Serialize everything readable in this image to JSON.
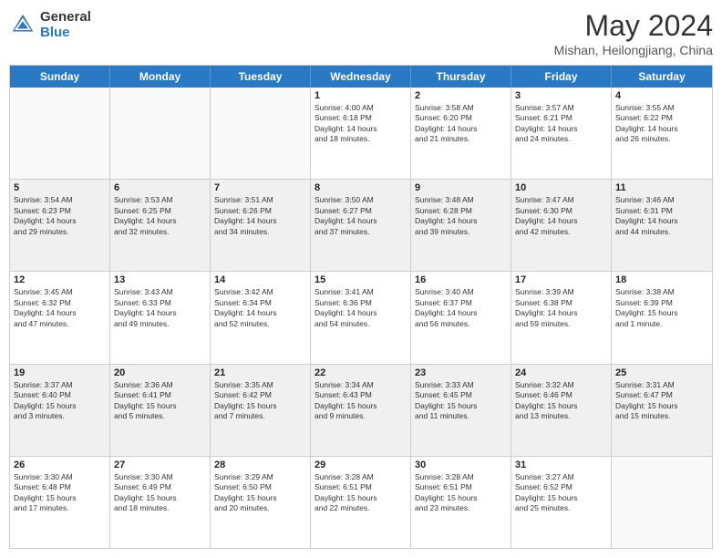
{
  "logo": {
    "line1": "General",
    "line2": "Blue"
  },
  "title": "May 2024",
  "location": "Mishan, Heilongjiang, China",
  "days_of_week": [
    "Sunday",
    "Monday",
    "Tuesday",
    "Wednesday",
    "Thursday",
    "Friday",
    "Saturday"
  ],
  "weeks": [
    [
      {
        "day": "",
        "info": ""
      },
      {
        "day": "",
        "info": ""
      },
      {
        "day": "",
        "info": ""
      },
      {
        "day": "1",
        "info": "Sunrise: 4:00 AM\nSunset: 6:18 PM\nDaylight: 14 hours\nand 18 minutes."
      },
      {
        "day": "2",
        "info": "Sunrise: 3:58 AM\nSunset: 6:20 PM\nDaylight: 14 hours\nand 21 minutes."
      },
      {
        "day": "3",
        "info": "Sunrise: 3:57 AM\nSunset: 6:21 PM\nDaylight: 14 hours\nand 24 minutes."
      },
      {
        "day": "4",
        "info": "Sunrise: 3:55 AM\nSunset: 6:22 PM\nDaylight: 14 hours\nand 26 minutes."
      }
    ],
    [
      {
        "day": "5",
        "info": "Sunrise: 3:54 AM\nSunset: 6:23 PM\nDaylight: 14 hours\nand 29 minutes."
      },
      {
        "day": "6",
        "info": "Sunrise: 3:53 AM\nSunset: 6:25 PM\nDaylight: 14 hours\nand 32 minutes."
      },
      {
        "day": "7",
        "info": "Sunrise: 3:51 AM\nSunset: 6:26 PM\nDaylight: 14 hours\nand 34 minutes."
      },
      {
        "day": "8",
        "info": "Sunrise: 3:50 AM\nSunset: 6:27 PM\nDaylight: 14 hours\nand 37 minutes."
      },
      {
        "day": "9",
        "info": "Sunrise: 3:48 AM\nSunset: 6:28 PM\nDaylight: 14 hours\nand 39 minutes."
      },
      {
        "day": "10",
        "info": "Sunrise: 3:47 AM\nSunset: 6:30 PM\nDaylight: 14 hours\nand 42 minutes."
      },
      {
        "day": "11",
        "info": "Sunrise: 3:46 AM\nSunset: 6:31 PM\nDaylight: 14 hours\nand 44 minutes."
      }
    ],
    [
      {
        "day": "12",
        "info": "Sunrise: 3:45 AM\nSunset: 6:32 PM\nDaylight: 14 hours\nand 47 minutes."
      },
      {
        "day": "13",
        "info": "Sunrise: 3:43 AM\nSunset: 6:33 PM\nDaylight: 14 hours\nand 49 minutes."
      },
      {
        "day": "14",
        "info": "Sunrise: 3:42 AM\nSunset: 6:34 PM\nDaylight: 14 hours\nand 52 minutes."
      },
      {
        "day": "15",
        "info": "Sunrise: 3:41 AM\nSunset: 6:36 PM\nDaylight: 14 hours\nand 54 minutes."
      },
      {
        "day": "16",
        "info": "Sunrise: 3:40 AM\nSunset: 6:37 PM\nDaylight: 14 hours\nand 56 minutes."
      },
      {
        "day": "17",
        "info": "Sunrise: 3:39 AM\nSunset: 6:38 PM\nDaylight: 14 hours\nand 59 minutes."
      },
      {
        "day": "18",
        "info": "Sunrise: 3:38 AM\nSunset: 6:39 PM\nDaylight: 15 hours\nand 1 minute."
      }
    ],
    [
      {
        "day": "19",
        "info": "Sunrise: 3:37 AM\nSunset: 6:40 PM\nDaylight: 15 hours\nand 3 minutes."
      },
      {
        "day": "20",
        "info": "Sunrise: 3:36 AM\nSunset: 6:41 PM\nDaylight: 15 hours\nand 5 minutes."
      },
      {
        "day": "21",
        "info": "Sunrise: 3:35 AM\nSunset: 6:42 PM\nDaylight: 15 hours\nand 7 minutes."
      },
      {
        "day": "22",
        "info": "Sunrise: 3:34 AM\nSunset: 6:43 PM\nDaylight: 15 hours\nand 9 minutes."
      },
      {
        "day": "23",
        "info": "Sunrise: 3:33 AM\nSunset: 6:45 PM\nDaylight: 15 hours\nand 11 minutes."
      },
      {
        "day": "24",
        "info": "Sunrise: 3:32 AM\nSunset: 6:46 PM\nDaylight: 15 hours\nand 13 minutes."
      },
      {
        "day": "25",
        "info": "Sunrise: 3:31 AM\nSunset: 6:47 PM\nDaylight: 15 hours\nand 15 minutes."
      }
    ],
    [
      {
        "day": "26",
        "info": "Sunrise: 3:30 AM\nSunset: 6:48 PM\nDaylight: 15 hours\nand 17 minutes."
      },
      {
        "day": "27",
        "info": "Sunrise: 3:30 AM\nSunset: 6:49 PM\nDaylight: 15 hours\nand 18 minutes."
      },
      {
        "day": "28",
        "info": "Sunrise: 3:29 AM\nSunset: 6:50 PM\nDaylight: 15 hours\nand 20 minutes."
      },
      {
        "day": "29",
        "info": "Sunrise: 3:28 AM\nSunset: 6:51 PM\nDaylight: 15 hours\nand 22 minutes."
      },
      {
        "day": "30",
        "info": "Sunrise: 3:28 AM\nSunset: 6:51 PM\nDaylight: 15 hours\nand 23 minutes."
      },
      {
        "day": "31",
        "info": "Sunrise: 3:27 AM\nSunset: 6:52 PM\nDaylight: 15 hours\nand 25 minutes."
      },
      {
        "day": "",
        "info": ""
      }
    ]
  ]
}
